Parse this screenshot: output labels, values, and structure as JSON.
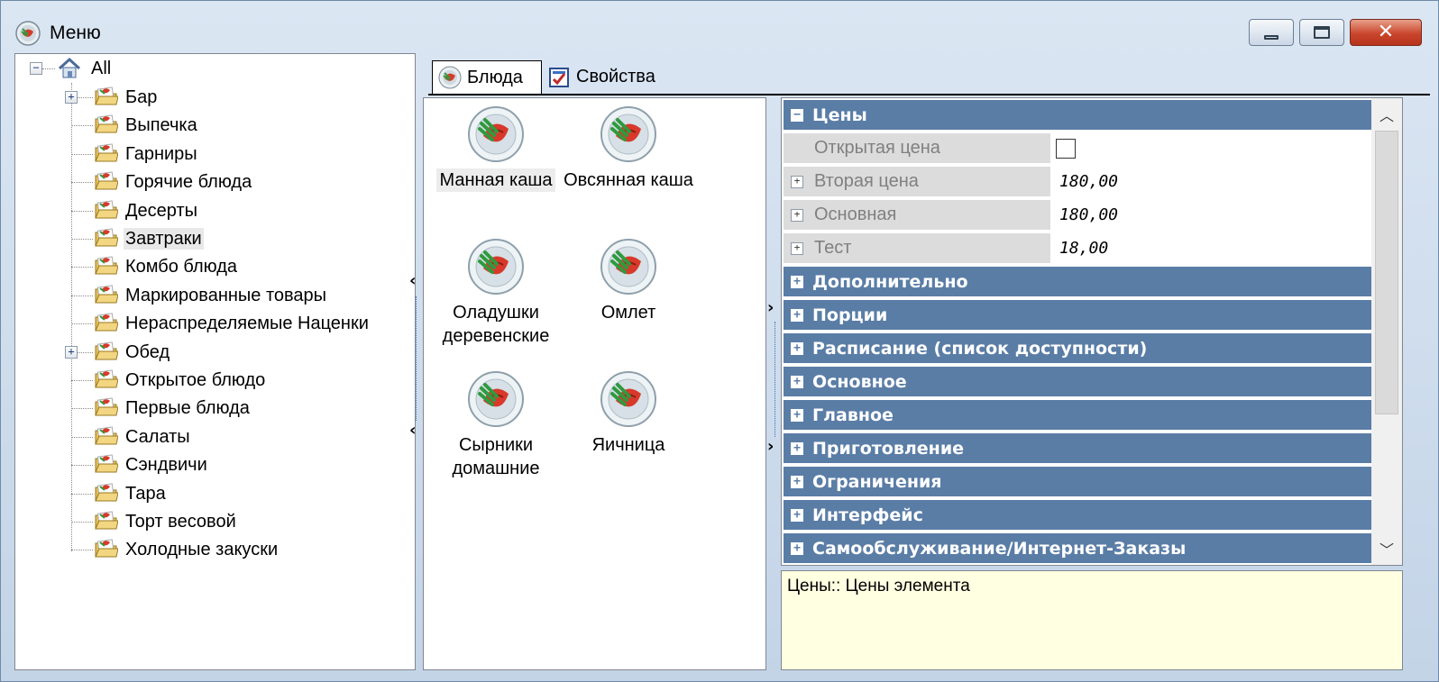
{
  "window": {
    "title": "Меню"
  },
  "tree": {
    "root": "All",
    "items": [
      {
        "label": "Бар",
        "expandable": true
      },
      {
        "label": "Выпечка",
        "expandable": false
      },
      {
        "label": "Гарниры",
        "expandable": false
      },
      {
        "label": "Горячие блюда",
        "expandable": false
      },
      {
        "label": "Десерты",
        "expandable": false
      },
      {
        "label": "Завтраки",
        "expandable": false,
        "selected": true
      },
      {
        "label": "Комбо блюда",
        "expandable": false
      },
      {
        "label": "Маркированные товары",
        "expandable": false
      },
      {
        "label": "Нераспределяемые Наценки",
        "expandable": false
      },
      {
        "label": "Обед",
        "expandable": true
      },
      {
        "label": "Открытое блюдо",
        "expandable": false
      },
      {
        "label": "Первые блюда",
        "expandable": false
      },
      {
        "label": "Салаты",
        "expandable": false
      },
      {
        "label": "Сэндвичи",
        "expandable": false
      },
      {
        "label": "Тара",
        "expandable": false
      },
      {
        "label": "Торт весовой",
        "expandable": false
      },
      {
        "label": "Холодные закуски",
        "expandable": false
      }
    ]
  },
  "tabs": [
    {
      "label": "Блюда",
      "active": true
    },
    {
      "label": "Свойства",
      "active": false
    }
  ],
  "dishes": [
    {
      "label": "Манная каша",
      "selected": true
    },
    {
      "label": "Овсянная каша"
    },
    {
      "label": "Оладушки деревенские"
    },
    {
      "label": "Омлет"
    },
    {
      "label": "Сырники домашние"
    },
    {
      "label": "Яичница"
    }
  ],
  "properties": {
    "prices": {
      "category": "Цены",
      "open_price": "Открытая цена",
      "second_price": {
        "name": "Вторая цена",
        "value": "180,00"
      },
      "main_price": {
        "name": "Основная",
        "value": "180,00"
      },
      "test_price": {
        "name": "Тест",
        "value": "18,00"
      }
    },
    "categories": [
      "Дополнительно",
      "Порции",
      "Расписание (список доступности)",
      "Основное",
      "Главное",
      "Приготовление",
      "Ограничения",
      "Интерфейс",
      "Самообслуживание/Интернет-Заказы"
    ]
  },
  "description": "Цены:: Цены элемента",
  "colors": {
    "category_bg": "#5a7da6",
    "description_bg": "#ffffe1",
    "close_button": "#c9462c"
  },
  "icons": {
    "window": "app-plate-icon",
    "folder": "folder-icon",
    "dish": "dish-plate-icon",
    "properties_tab": "checklist-icon"
  }
}
